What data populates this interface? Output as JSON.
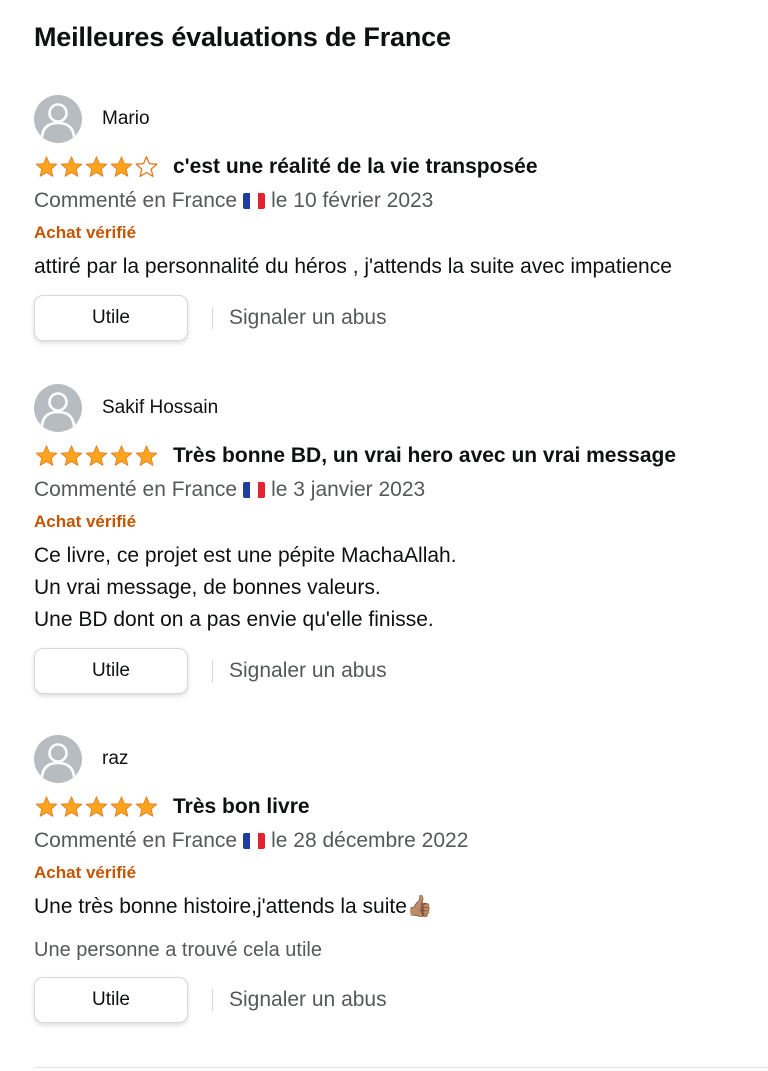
{
  "page_title": "Meilleures évaluations de France",
  "colors": {
    "star": "#ffa41c",
    "verified": "#c45500",
    "muted": "#565959"
  },
  "reviews": [
    {
      "author": "Mario",
      "rating": 4,
      "title": "c'est une réalité de la vie transposée",
      "meta_prefix": "Commenté en France",
      "meta_date": "le 10 février 2023",
      "verified": "Achat vérifié",
      "body": [
        "attiré par la personnalité du héros , j'attends la suite avec impatience"
      ],
      "helpful_label": "Utile",
      "report_label": "Signaler un abus"
    },
    {
      "author": "Sakif Hossain",
      "rating": 5,
      "title": "Très bonne BD, un vrai hero avec un vrai message",
      "meta_prefix": "Commenté en France",
      "meta_date": "le 3 janvier 2023",
      "verified": "Achat vérifié",
      "body": [
        "Ce livre, ce projet est une pépite MachaAllah.",
        "Un vrai message, de bonnes valeurs.",
        "Une BD dont on a pas envie qu'elle finisse."
      ],
      "helpful_label": "Utile",
      "report_label": "Signaler un abus"
    },
    {
      "author": "raz",
      "rating": 5,
      "title": "Très bon livre",
      "meta_prefix": "Commenté en France",
      "meta_date": "le 28 décembre 2022",
      "verified": "Achat vérifié",
      "body": [
        "Une très bonne histoire,j'attends la suite👍🏽"
      ],
      "helpful_count": "Une personne a trouvé cela utile",
      "helpful_label": "Utile",
      "report_label": "Signaler un abus"
    }
  ]
}
